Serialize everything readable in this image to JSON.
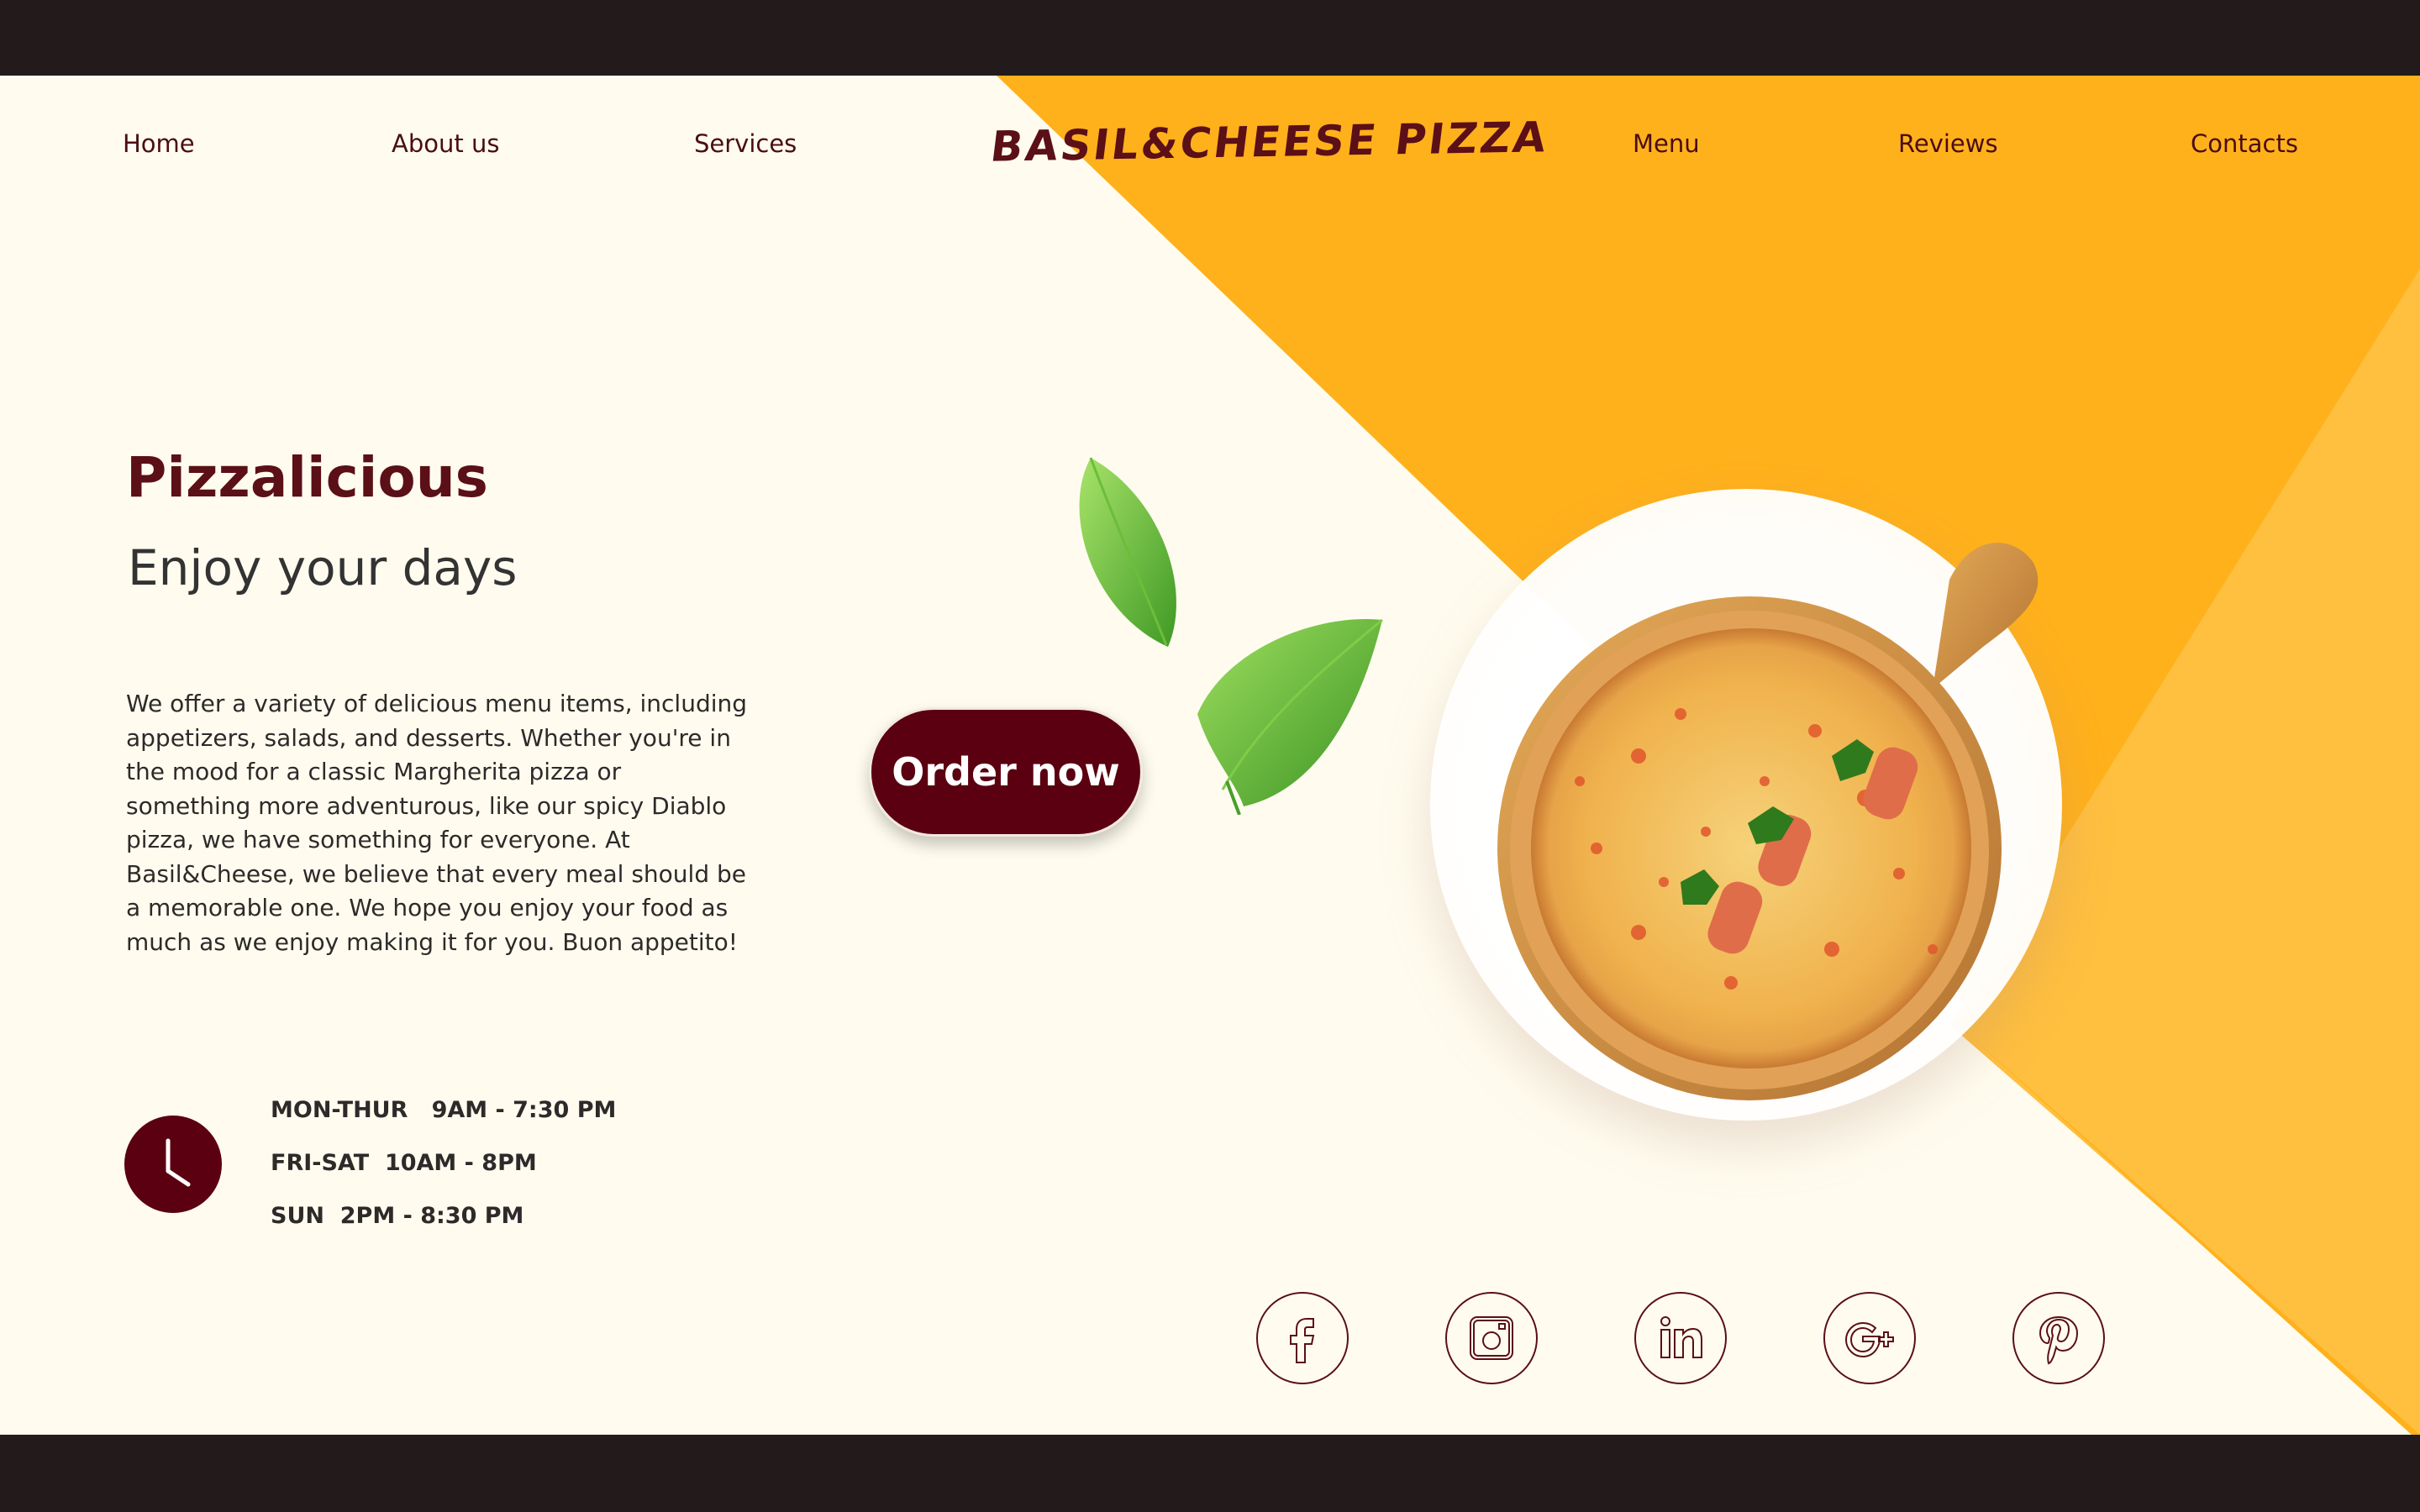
{
  "brand": {
    "logo_text": "BASIL&CHEESE PIZZA"
  },
  "nav": {
    "left": [
      {
        "label": "Home"
      },
      {
        "label": "About us"
      },
      {
        "label": "Services"
      }
    ],
    "right": [
      {
        "label": "Menu"
      },
      {
        "label": "Reviews"
      },
      {
        "label": "Contacts"
      }
    ]
  },
  "hero": {
    "title": "Pizzalicious",
    "subtitle": "Enjoy your days",
    "description": "We offer a variety of delicious menu items, including appetizers, salads, and desserts. Whether you're in the mood for a classic Margherita pizza or something more adventurous, like our spicy Diablo pizza, we have something for everyone. At Basil&Cheese, we believe that every meal should be a memorable one. We hope you enjoy your food as much as we enjoy making it for you. Buon appetito!",
    "cta_label": "Order now"
  },
  "hours": {
    "icon": "clock-icon",
    "rows": [
      {
        "text": "MON-THUR   9AM - 7:30 PM"
      },
      {
        "text": "FRI-SAT  10AM - 8PM"
      },
      {
        "text": "SUN  2PM - 8:30 PM"
      }
    ]
  },
  "social": [
    {
      "icon": "facebook-icon"
    },
    {
      "icon": "instagram-icon"
    },
    {
      "icon": "linkedin-icon"
    },
    {
      "icon": "google-plus-icon"
    },
    {
      "icon": "pinterest-icon"
    }
  ],
  "colors": {
    "background": "#fffcef",
    "frame": "#231a1c",
    "accent_orange": "#ffb11c",
    "accent_light_orange": "#ffc042",
    "brand_maroon": "#5b0010",
    "text_dark": "#2e2a2a"
  }
}
